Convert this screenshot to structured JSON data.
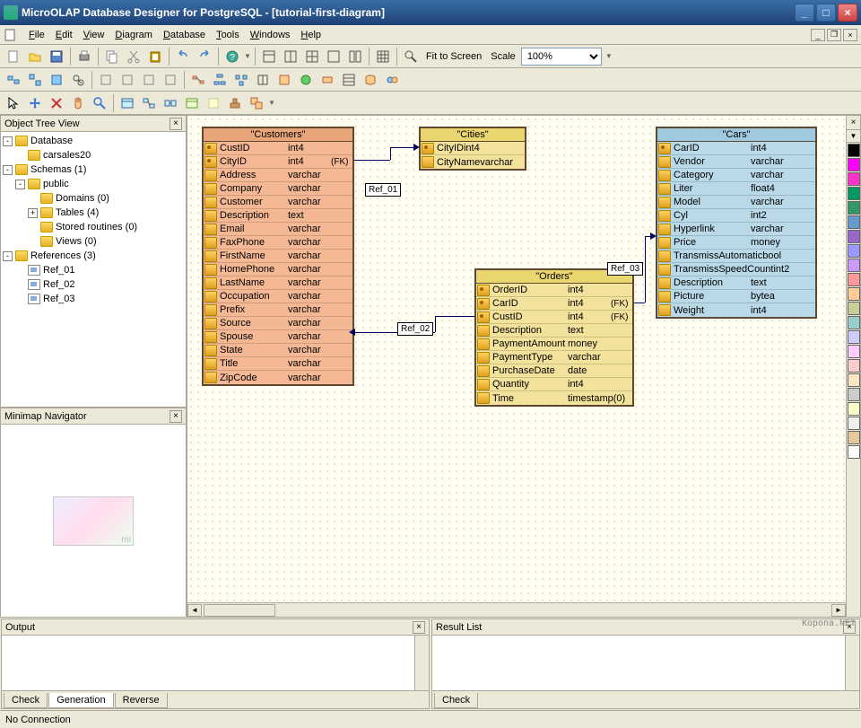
{
  "window": {
    "title": "MicroOLAP Database Designer for PostgreSQL - [tutorial-first-diagram]"
  },
  "menu": {
    "items": [
      "File",
      "Edit",
      "View",
      "Diagram",
      "Database",
      "Tools",
      "Windows",
      "Help"
    ]
  },
  "toolbar": {
    "fit_label": "Fit to Screen",
    "scale_label": "Scale",
    "scale_value": "100%"
  },
  "left": {
    "tree_title": "Object Tree View",
    "minimap_title": "Minimap Navigator",
    "nodes": {
      "database": "Database",
      "db_name": "carsales20",
      "schemas": "Schemas (1)",
      "public": "public",
      "domains": "Domains (0)",
      "tables": "Tables (4)",
      "stored": "Stored routines (0)",
      "views": "Views (0)",
      "references": "References (3)",
      "ref1": "Ref_01",
      "ref2": "Ref_02",
      "ref3": "Ref_03"
    }
  },
  "tables": {
    "customers": {
      "title": "\"Customers\"",
      "cols": [
        {
          "n": "CustID",
          "t": "int4",
          "pk": true,
          "fk": ""
        },
        {
          "n": "CityID",
          "t": "int4",
          "pk": true,
          "fk": "(FK)"
        },
        {
          "n": "Address",
          "t": "varchar",
          "pk": false,
          "fk": ""
        },
        {
          "n": "Company",
          "t": "varchar",
          "pk": false,
          "fk": ""
        },
        {
          "n": "Customer",
          "t": "varchar",
          "pk": false,
          "fk": ""
        },
        {
          "n": "Description",
          "t": "text",
          "pk": false,
          "fk": ""
        },
        {
          "n": "Email",
          "t": "varchar",
          "pk": false,
          "fk": ""
        },
        {
          "n": "FaxPhone",
          "t": "varchar",
          "pk": false,
          "fk": ""
        },
        {
          "n": "FirstName",
          "t": "varchar",
          "pk": false,
          "fk": ""
        },
        {
          "n": "HomePhone",
          "t": "varchar",
          "pk": false,
          "fk": ""
        },
        {
          "n": "LastName",
          "t": "varchar",
          "pk": false,
          "fk": ""
        },
        {
          "n": "Occupation",
          "t": "varchar",
          "pk": false,
          "fk": ""
        },
        {
          "n": "Prefix",
          "t": "varchar",
          "pk": false,
          "fk": ""
        },
        {
          "n": "Source",
          "t": "varchar",
          "pk": false,
          "fk": ""
        },
        {
          "n": "Spouse",
          "t": "varchar",
          "pk": false,
          "fk": ""
        },
        {
          "n": "State",
          "t": "varchar",
          "pk": false,
          "fk": ""
        },
        {
          "n": "Title",
          "t": "varchar",
          "pk": false,
          "fk": ""
        },
        {
          "n": "ZipCode",
          "t": "varchar",
          "pk": false,
          "fk": ""
        }
      ]
    },
    "cities": {
      "title": "\"Cities\"",
      "cols": [
        {
          "n": "CityID",
          "t": "int4",
          "pk": true,
          "fk": ""
        },
        {
          "n": "CityName",
          "t": "varchar",
          "pk": false,
          "fk": ""
        }
      ]
    },
    "orders": {
      "title": "\"Orders\"",
      "cols": [
        {
          "n": "OrderID",
          "t": "int4",
          "pk": true,
          "fk": ""
        },
        {
          "n": "CarID",
          "t": "int4",
          "pk": true,
          "fk": "(FK)"
        },
        {
          "n": "CustID",
          "t": "int4",
          "pk": true,
          "fk": "(FK)"
        },
        {
          "n": "Description",
          "t": "text",
          "pk": false,
          "fk": ""
        },
        {
          "n": "PaymentAmount",
          "t": "money",
          "pk": false,
          "fk": ""
        },
        {
          "n": "PaymentType",
          "t": "varchar",
          "pk": false,
          "fk": ""
        },
        {
          "n": "PurchaseDate",
          "t": "date",
          "pk": false,
          "fk": ""
        },
        {
          "n": "Quantity",
          "t": "int4",
          "pk": false,
          "fk": ""
        },
        {
          "n": "Time",
          "t": "timestamp(0)",
          "pk": false,
          "fk": ""
        }
      ]
    },
    "cars": {
      "title": "\"Cars\"",
      "cols": [
        {
          "n": "CarID",
          "t": "int4",
          "pk": true,
          "fk": ""
        },
        {
          "n": "Vendor",
          "t": "varchar",
          "pk": false,
          "fk": ""
        },
        {
          "n": "Category",
          "t": "varchar",
          "pk": false,
          "fk": ""
        },
        {
          "n": "Liter",
          "t": "float4",
          "pk": false,
          "fk": ""
        },
        {
          "n": "Model",
          "t": "varchar",
          "pk": false,
          "fk": ""
        },
        {
          "n": "Cyl",
          "t": "int2",
          "pk": false,
          "fk": ""
        },
        {
          "n": "Hyperlink",
          "t": "varchar",
          "pk": false,
          "fk": ""
        },
        {
          "n": "Price",
          "t": "money",
          "pk": false,
          "fk": ""
        },
        {
          "n": "TransmissAutomatic",
          "t": "bool",
          "pk": false,
          "fk": ""
        },
        {
          "n": "TransmissSpeedCount",
          "t": "int2",
          "pk": false,
          "fk": ""
        },
        {
          "n": "Description",
          "t": "text",
          "pk": false,
          "fk": ""
        },
        {
          "n": "Picture",
          "t": "bytea",
          "pk": false,
          "fk": ""
        },
        {
          "n": "Weight",
          "t": "int4",
          "pk": false,
          "fk": ""
        }
      ]
    }
  },
  "refs": {
    "r1": "Ref_01",
    "r2": "Ref_02",
    "r3": "Ref_03"
  },
  "palette": [
    "#000000",
    "#ff00ff",
    "#ff33cc",
    "#009966",
    "#339966",
    "#6699cc",
    "#9966cc",
    "#9999ff",
    "#cc99ff",
    "#ff9999",
    "#ffcc99",
    "#cccc99",
    "#99cccc",
    "#ccccff",
    "#ffccff",
    "#ffcccc",
    "#ffe7c6",
    "#cccccc",
    "#ffffcc",
    "#eeeeee",
    "#e6c89c",
    "#ffffff"
  ],
  "bottom": {
    "output_title": "Output",
    "result_title": "Result List",
    "tabs": {
      "check": "Check",
      "generation": "Generation",
      "reverse": "Reverse"
    }
  },
  "status": {
    "text": "No Connection"
  },
  "watermark": "Kopona.NET"
}
